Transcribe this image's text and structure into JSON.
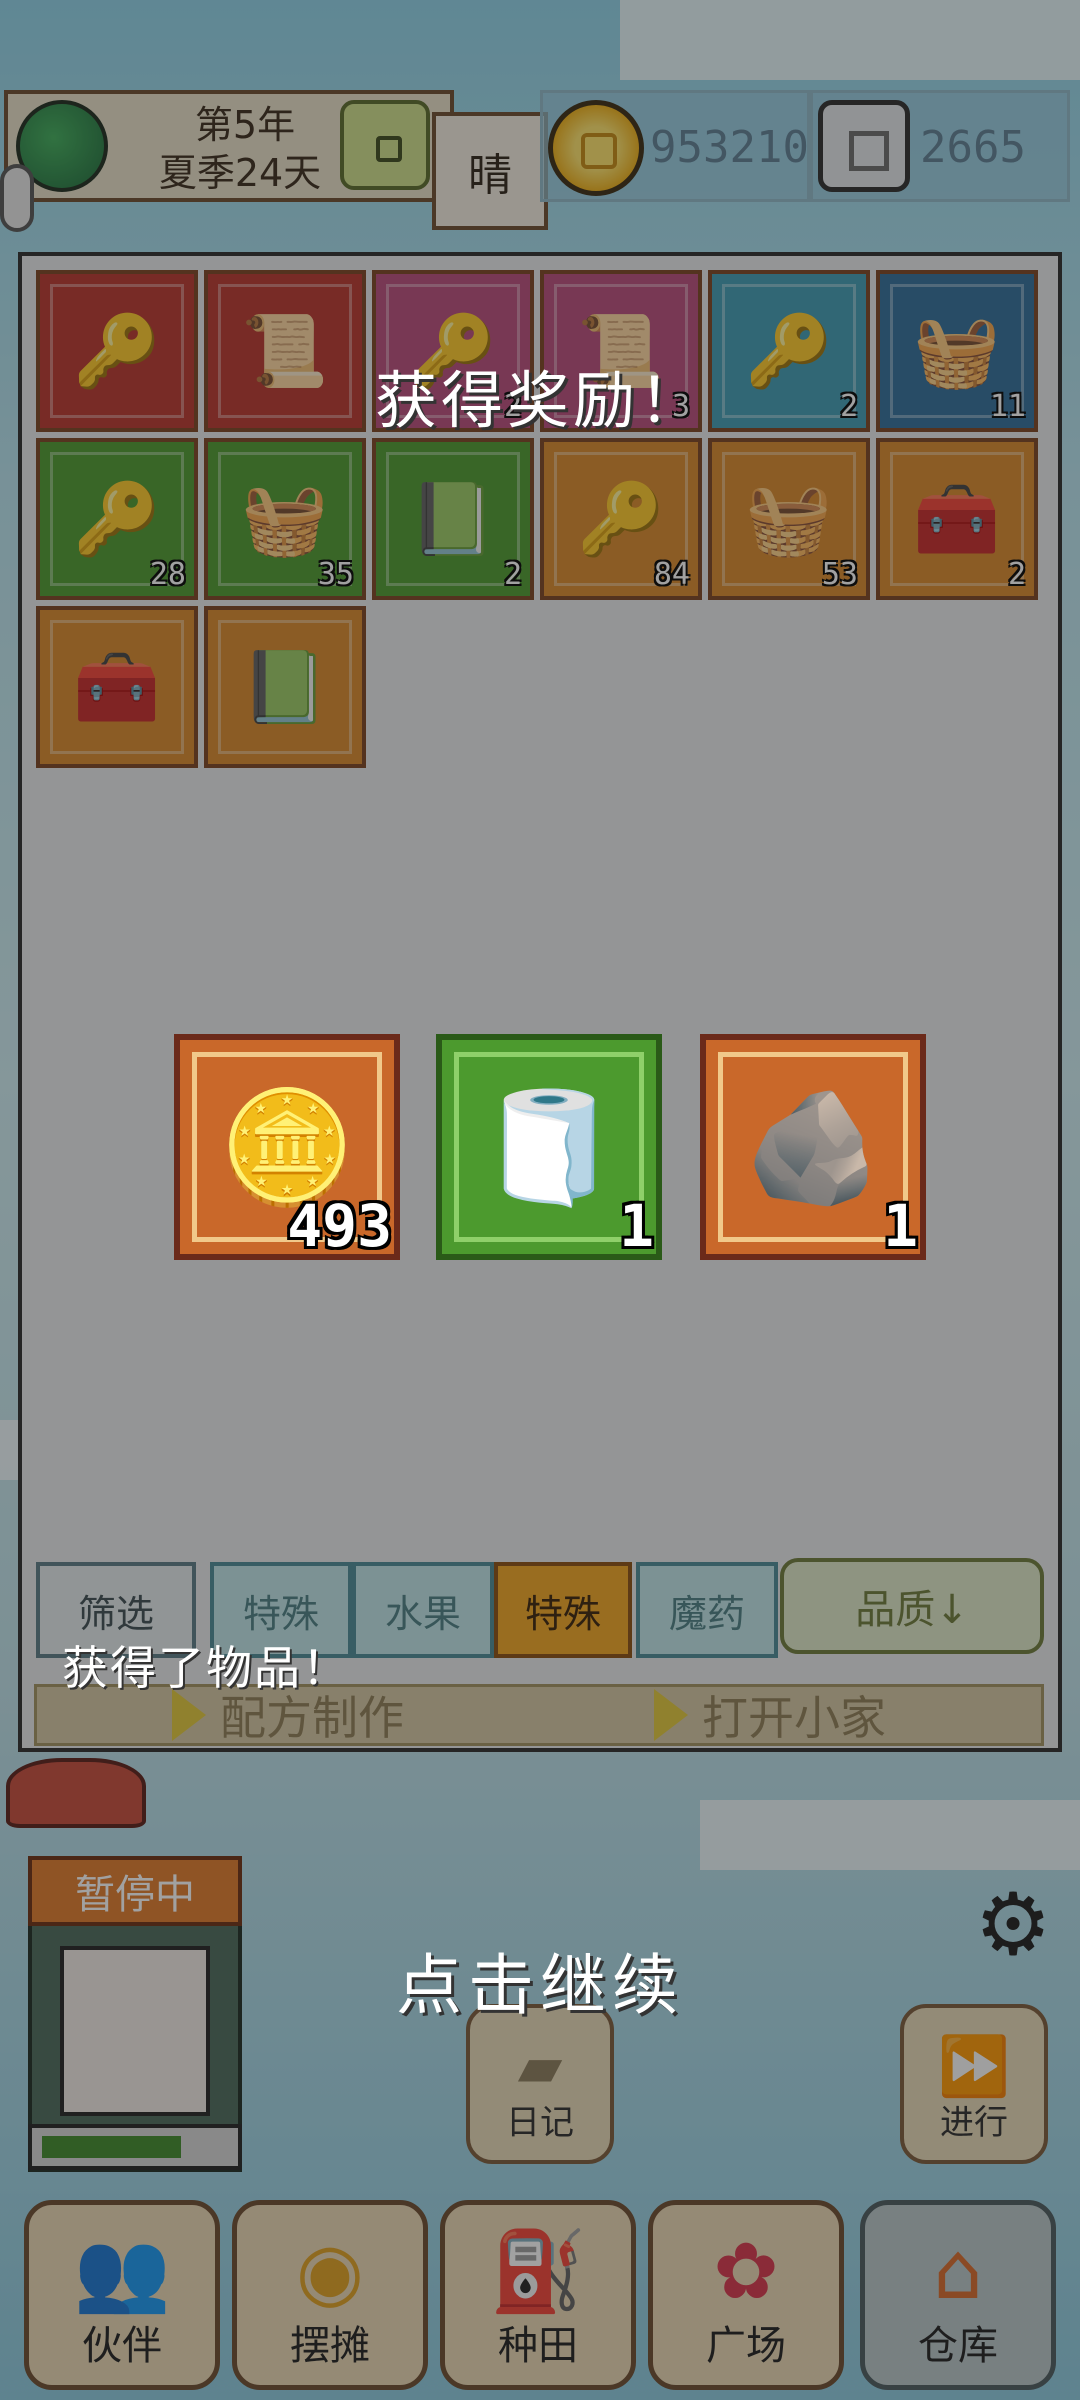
{
  "header": {
    "date_line1": "第5年",
    "date_line2": "夏季24天",
    "weather": "晴",
    "gold": "953210",
    "gems": "2665"
  },
  "inventory": {
    "slots": [
      {
        "icon": "key-icon",
        "count": "",
        "color": "red"
      },
      {
        "icon": "map-scroll-icon",
        "count": "",
        "color": "red"
      },
      {
        "icon": "key-icon",
        "count": "2",
        "color": "rose"
      },
      {
        "icon": "map-scroll-icon",
        "count": "3",
        "color": "rose"
      },
      {
        "icon": "key-icon",
        "count": "2",
        "color": "teal"
      },
      {
        "icon": "basket-icon",
        "count": "11",
        "color": "navy"
      },
      {
        "icon": "key-icon",
        "count": "28",
        "color": "green"
      },
      {
        "icon": "basket-icon",
        "count": "35",
        "color": "green"
      },
      {
        "icon": "book-icon",
        "count": "2",
        "color": "green"
      },
      {
        "icon": "key-icon",
        "count": "84",
        "color": "orange"
      },
      {
        "icon": "basket-icon",
        "count": "53",
        "color": "orange"
      },
      {
        "icon": "chest-icon",
        "count": "2",
        "color": "orange"
      },
      {
        "icon": "chest-icon",
        "count": "",
        "color": "orange"
      },
      {
        "icon": "book-icon",
        "count": "",
        "color": "orange"
      }
    ]
  },
  "filters": {
    "filter_label": "筛选",
    "tabs": [
      "特殊",
      "水果",
      "特殊",
      "魔药"
    ],
    "quality_label": "品质↓"
  },
  "actions": {
    "recipe": "配方制作",
    "open_home": "打开小家"
  },
  "character": {
    "status": "暂停中",
    "hp_fraction": 0.78
  },
  "side_buttons": {
    "diary": "日记",
    "proceed": "进行"
  },
  "nav": [
    {
      "label": "伙伴",
      "icon": "partners-icon"
    },
    {
      "label": "摆摊",
      "icon": "stall-icon"
    },
    {
      "label": "种田",
      "icon": "watering-can-icon"
    },
    {
      "label": "广场",
      "icon": "flower-icon"
    },
    {
      "label": "仓库",
      "icon": "house-icon"
    }
  ],
  "overlay": {
    "title": "获得奖励！",
    "rewards": [
      {
        "icon": "gold-coin-icon",
        "count": "493",
        "color": "orange"
      },
      {
        "icon": "cloth-icon",
        "count": "1",
        "color": "green"
      },
      {
        "icon": "stone-icon",
        "count": "1",
        "color": "orange"
      }
    ],
    "toast": "获得了物品！",
    "continue": "点击继续"
  },
  "colors": {
    "panel_bg": "#e9ebec",
    "slot_border": "#7a4220",
    "pause_orange": "#e07a2a",
    "hp_green": "#3e8a2a"
  }
}
